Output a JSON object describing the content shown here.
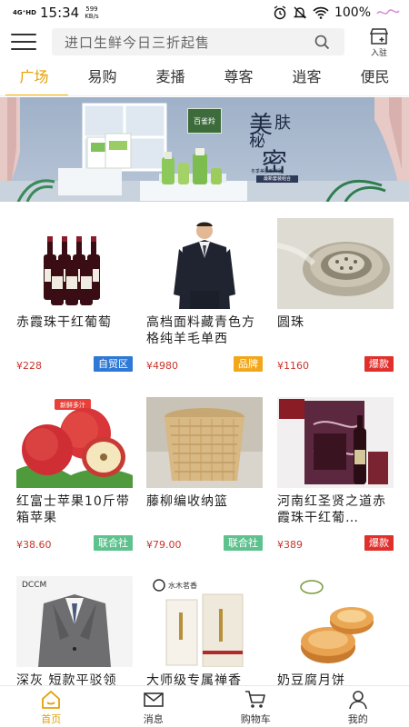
{
  "status_bar": {
    "network": "4G⁺HD",
    "time": "15:34",
    "speed_value": "599",
    "speed_unit": "KB/s",
    "battery": "100%"
  },
  "header": {
    "search_placeholder": "进口生鲜今日三折起售",
    "join_label": "入驻"
  },
  "tabs": [
    {
      "label": "广场",
      "active": true
    },
    {
      "label": "易购",
      "active": false
    },
    {
      "label": "麦播",
      "active": false
    },
    {
      "label": "尊客",
      "active": false
    },
    {
      "label": "逍客",
      "active": false
    },
    {
      "label": "便民",
      "active": false
    }
  ],
  "banner": {
    "brand": "百雀羚",
    "line1": "美",
    "line1b": "肤",
    "line2": "秘",
    "line3": "密",
    "fine_print": "冬季美肤新体验",
    "pill": "最新套装组合"
  },
  "products": [
    {
      "name": "赤霞珠干红葡萄",
      "price": "¥228",
      "tag": "自贸区",
      "tag_color": "#2e78d6"
    },
    {
      "name": "高档面料藏青色方格纯羊毛单西",
      "price": "¥4980",
      "tag": "品牌",
      "tag_color": "#f2a71a"
    },
    {
      "name": "圆珠",
      "price": "¥1160",
      "tag": "爆款",
      "tag_color": "#e0302c"
    },
    {
      "name": "红富士苹果10斤带箱苹果",
      "price": "¥38.60",
      "tag": "联合社",
      "tag_color": "#5ec28e"
    },
    {
      "name": "藤柳编收纳篮",
      "price": "¥79.00",
      "tag": "联合社",
      "tag_color": "#5ec28e"
    },
    {
      "name": "河南红圣贤之道赤霞珠干红葡…",
      "price": "¥389",
      "tag": "爆款",
      "tag_color": "#e0302c"
    },
    {
      "name": "深灰 短款平驳领",
      "price": "",
      "tag": "",
      "tag_color": ""
    },
    {
      "name": "大师级专属禅香",
      "price": "",
      "tag": "",
      "tag_color": ""
    },
    {
      "name": "奶豆腐月饼",
      "price": "",
      "tag": "",
      "tag_color": ""
    }
  ],
  "product_image_texts": {
    "apple_badge": "新鲜多汁",
    "suit_brand": "DCCM",
    "incense_brand": "水木茗香"
  },
  "bottom_nav": [
    {
      "label": "首页",
      "icon": "home-icon",
      "active": true
    },
    {
      "label": "消息",
      "icon": "mail-icon",
      "active": false
    },
    {
      "label": "购物车",
      "icon": "cart-icon",
      "active": false
    },
    {
      "label": "我的",
      "icon": "user-icon",
      "active": false
    }
  ],
  "colors": {
    "accent": "#e3a006",
    "price": "#c9352b"
  }
}
